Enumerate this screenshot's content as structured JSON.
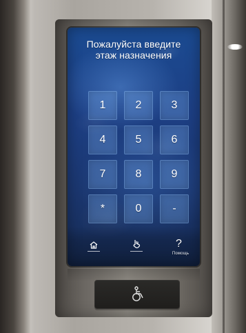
{
  "screen": {
    "prompt_line1": "Пожалуйста введите",
    "prompt_line2": "этаж назначения"
  },
  "keypad": {
    "keys": [
      "1",
      "2",
      "3",
      "4",
      "5",
      "6",
      "7",
      "8",
      "9",
      "*",
      "0",
      "-"
    ]
  },
  "bottom_nav": {
    "home_icon": "home-icon",
    "hand_icon": "hand-pointer-icon",
    "help_icon": "question-mark-icon",
    "help_label": "Помощь"
  },
  "accessibility": {
    "icon": "wheelchair-icon"
  },
  "colors": {
    "screen_blue": "#1d3f84",
    "key_fill": "#78aae6",
    "text_white": "#ffffff"
  }
}
